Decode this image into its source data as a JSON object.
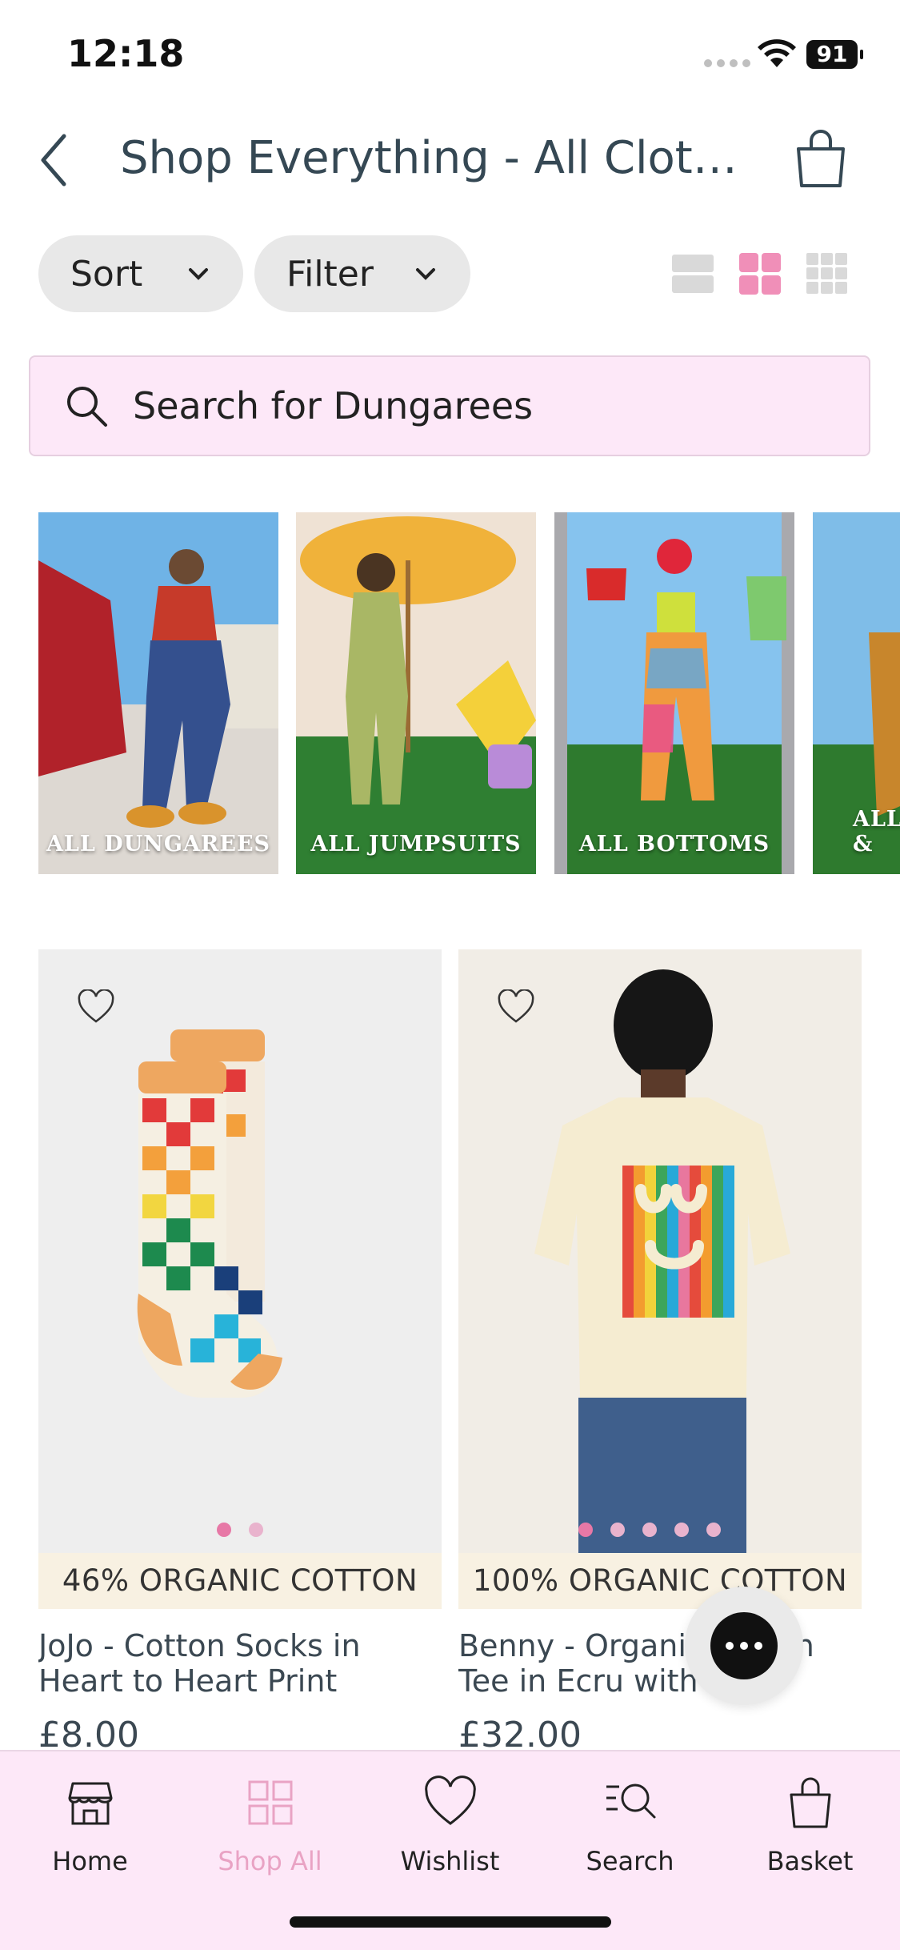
{
  "status": {
    "time": "12:18",
    "battery": "91"
  },
  "header": {
    "title": "Shop Everything - All Clothin..."
  },
  "controls": {
    "sort_label": "Sort",
    "filter_label": "Filter",
    "active_view": "grid-2"
  },
  "search": {
    "placeholder": "Search for Dungarees"
  },
  "categories": [
    {
      "label": "ALL DUNGAREES"
    },
    {
      "label": "ALL JUMPSUITS"
    },
    {
      "label": "ALL BOTTOMS"
    },
    {
      "label": "ALL &"
    }
  ],
  "products": [
    {
      "badge": "46% ORGANIC COTTON",
      "name": "JoJo - Cotton Socks in Heart to Heart Print",
      "price": "£8.00",
      "image_count": 2,
      "active_image": 1
    },
    {
      "badge": "100% ORGANIC COTTON",
      "name": "Benny - Organic Cotton Tee in Ecru with Logo Rainbow...",
      "price": "£32.00",
      "image_count": 5,
      "active_image": 1
    }
  ],
  "tabs": [
    {
      "label": "Home",
      "icon": "shop-front-icon"
    },
    {
      "label": "Shop All",
      "icon": "grid-icon",
      "active": true
    },
    {
      "label": "Wishlist",
      "icon": "heart-icon"
    },
    {
      "label": "Search",
      "icon": "search-list-icon"
    },
    {
      "label": "Basket",
      "icon": "bag-icon"
    }
  ],
  "colors": {
    "accent_pink": "#f08fb8",
    "search_bg": "#fde8f8",
    "badge_bg": "#f8f1e2"
  }
}
